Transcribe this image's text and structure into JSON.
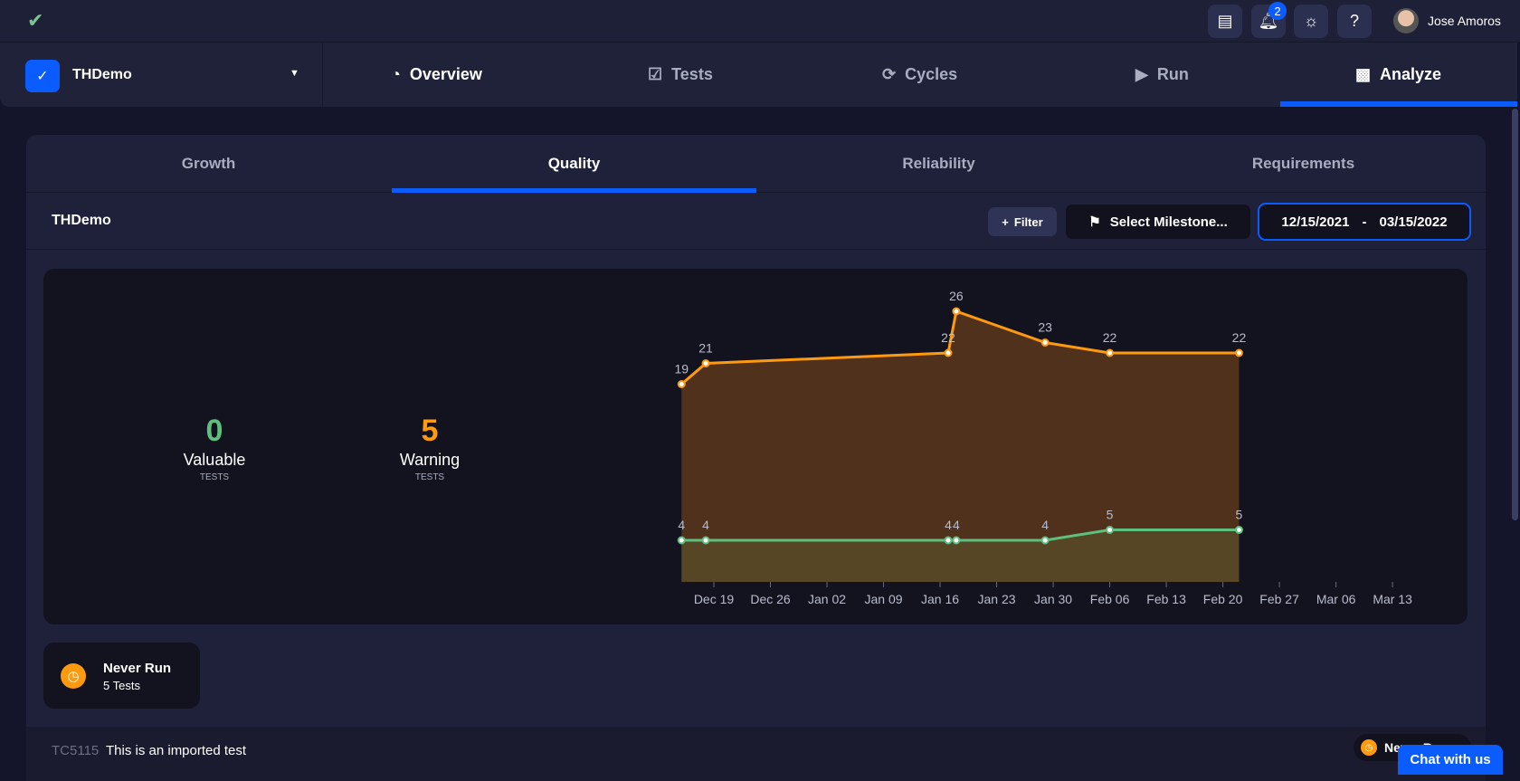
{
  "topbar": {
    "username": "Jose Amoros",
    "notification_count": "2"
  },
  "project": {
    "name": "THDemo"
  },
  "nav": {
    "tabs": [
      {
        "label": "Overview",
        "icon": "pie-icon"
      },
      {
        "label": "Tests",
        "icon": "clipboard-icon"
      },
      {
        "label": "Cycles",
        "icon": "cycle-icon"
      },
      {
        "label": "Run",
        "icon": "play-icon"
      },
      {
        "label": "Analyze",
        "icon": "bar-chart-icon"
      }
    ],
    "active": "Analyze"
  },
  "subtabs": {
    "items": [
      "Growth",
      "Quality",
      "Reliability",
      "Requirements"
    ],
    "active": "Quality"
  },
  "toolbar": {
    "title": "THDemo",
    "filter": "Filter",
    "milestone": "Select Milestone...",
    "date_from": "12/15/2021",
    "date_sep": "-",
    "date_to": "03/15/2022"
  },
  "stats": {
    "valuable": {
      "value": "0",
      "label": "Valuable",
      "sub": "TESTS"
    },
    "warning": {
      "value": "5",
      "label": "Warning",
      "sub": "TESTS"
    }
  },
  "colors": {
    "accent": "#0a5cff",
    "warning": "#ff9a0f",
    "valuable": "#5fbf7d"
  },
  "chart_data": {
    "type": "area",
    "x": [
      "2021-12-15",
      "2021-12-18",
      "2022-01-17",
      "2022-01-18",
      "2022-01-29",
      "2022-02-06",
      "2022-02-22"
    ],
    "series": [
      {
        "name": "Warning",
        "color": "#ff9a0f",
        "values": [
          19,
          21,
          22,
          26,
          23,
          22,
          22
        ]
      },
      {
        "name": "Valuable",
        "color": "#5fbf7d",
        "values": [
          4,
          4,
          4,
          4,
          4,
          5,
          5
        ]
      }
    ],
    "xticks": [
      "Dec 19",
      "Dec 26",
      "Jan 02",
      "Jan 09",
      "Jan 16",
      "Jan 23",
      "Jan 30",
      "Feb 06",
      "Feb 13",
      "Feb 20",
      "Feb 27",
      "Mar 06",
      "Mar 13"
    ],
    "xrange": [
      "2021-12-15",
      "2022-03-15"
    ],
    "ylim": [
      0,
      30
    ],
    "grid": false,
    "data_labels": true
  },
  "never_run": {
    "title": "Never Run",
    "count": "5 Tests"
  },
  "list": [
    {
      "id": "TC5115",
      "title": "This is an imported test",
      "status": "Never Run"
    }
  ],
  "chat": {
    "label": "Chat with us"
  }
}
